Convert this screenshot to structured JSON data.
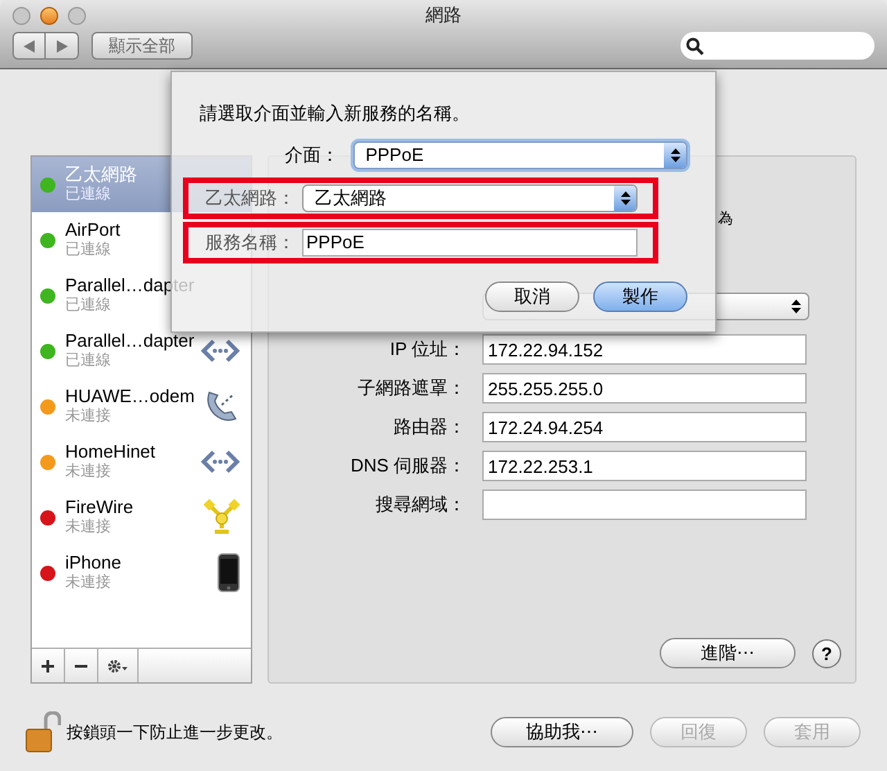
{
  "window": {
    "title": "網路"
  },
  "toolbar": {
    "show_all": "顯示全部"
  },
  "services": [
    {
      "name": "乙太網路",
      "status": "已連線",
      "color": "#3fb51f",
      "selected": true,
      "kind": "plain"
    },
    {
      "name": "AirPort",
      "status": "已連線",
      "color": "#3fb51f",
      "selected": false,
      "kind": "plain"
    },
    {
      "name": "Parallel…dapter",
      "status": "已連線",
      "color": "#3fb51f",
      "selected": false,
      "kind": "plain"
    },
    {
      "name": "Parallel…dapter",
      "status": "已連線",
      "color": "#3fb51f",
      "selected": false,
      "kind": "ethernet"
    },
    {
      "name": "HUAWE…odem",
      "status": "未連接",
      "color": "#f39a1c",
      "selected": false,
      "kind": "modem"
    },
    {
      "name": "HomeHinet",
      "status": "未連接",
      "color": "#f39a1c",
      "selected": false,
      "kind": "ethernet"
    },
    {
      "name": "FireWire",
      "status": "未連接",
      "color": "#d7141a",
      "selected": false,
      "kind": "firewire"
    },
    {
      "name": "iPhone",
      "status": "未連接",
      "color": "#d7141a",
      "selected": false,
      "kind": "phone"
    }
  ],
  "panel": {
    "fragment": "為",
    "fields": [
      {
        "label": "IP 位址：",
        "value": "172.22.94.152"
      },
      {
        "label": "子網路遮罩：",
        "value": "255.255.255.0"
      },
      {
        "label": "路由器：",
        "value": "172.24.94.254"
      },
      {
        "label": "DNS 伺服器：",
        "value": "172.22.253.1"
      },
      {
        "label": "搜尋網域："
      }
    ],
    "advanced": "進階⋯",
    "help": "?"
  },
  "sheet": {
    "message": "請選取介面並輸入新服務的名稱。",
    "interface": {
      "label": "介面：",
      "value": "PPPoE"
    },
    "ethernet": {
      "label": "乙太網路：",
      "value": "乙太網路"
    },
    "service_name": {
      "label": "服務名稱：",
      "value": "PPPoE"
    },
    "cancel": "取消",
    "create": "製作"
  },
  "footer": {
    "lock_text": "按鎖頭一下防止進一步更改。",
    "assist": "協助我⋯",
    "revert": "回復",
    "apply": "套用"
  }
}
